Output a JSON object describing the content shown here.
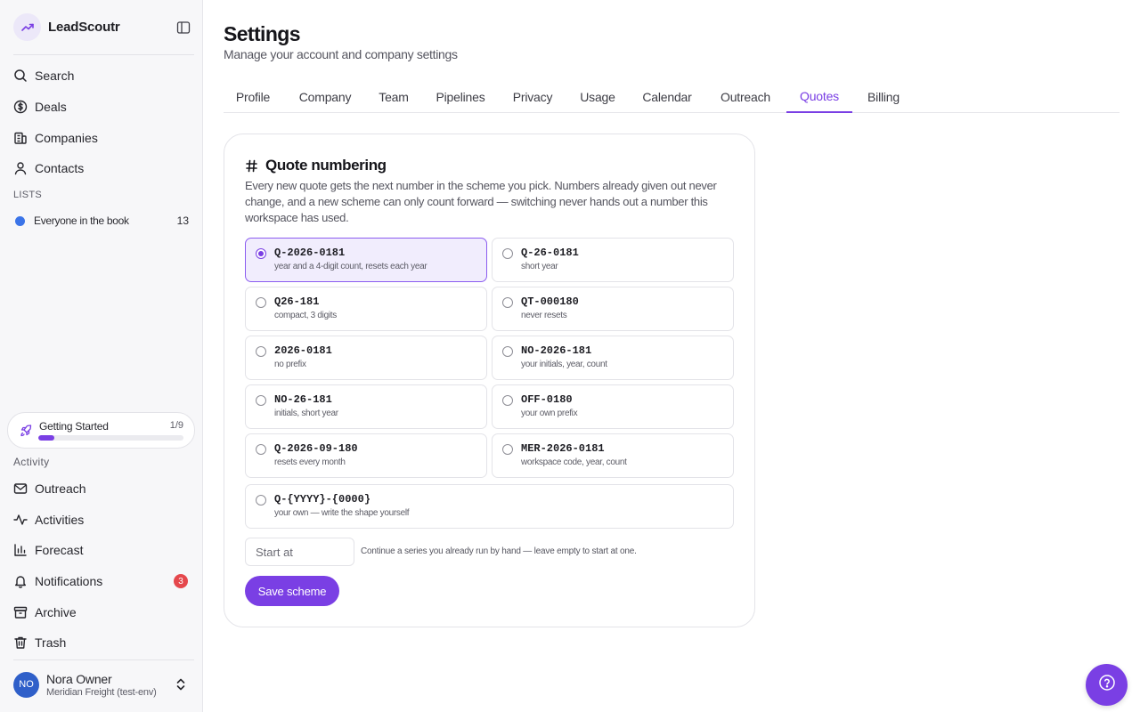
{
  "app": {
    "name": "LeadScoutr"
  },
  "sidebar": {
    "nav": [
      {
        "label": "Search",
        "icon": "search-icon"
      },
      {
        "label": "Deals",
        "icon": "dollar-icon"
      },
      {
        "label": "Companies",
        "icon": "building-icon"
      },
      {
        "label": "Contacts",
        "icon": "user-icon"
      }
    ],
    "lists_label": "LISTS",
    "lists": [
      {
        "name": "Everyone in the book",
        "count": "13",
        "color": "#3b74e8"
      }
    ],
    "getting_started": {
      "title": "Getting Started",
      "progress_text": "1/9",
      "progress": 0.11
    },
    "activity_label": "Activity",
    "activity": [
      {
        "label": "Outreach",
        "icon": "mail-icon"
      },
      {
        "label": "Activities",
        "icon": "activity-icon"
      },
      {
        "label": "Forecast",
        "icon": "bar-chart-icon"
      },
      {
        "label": "Notifications",
        "icon": "bell-icon",
        "badge": "3"
      },
      {
        "label": "Archive",
        "icon": "archive-icon"
      },
      {
        "label": "Trash",
        "icon": "trash-icon"
      }
    ],
    "user": {
      "initials": "NO",
      "name": "Nora Owner",
      "org": "Meridian Freight (test-env)"
    }
  },
  "page": {
    "title": "Settings",
    "subtitle": "Manage your account and company settings"
  },
  "tabs": [
    "Profile",
    "Company",
    "Team",
    "Pipelines",
    "Privacy",
    "Usage",
    "Calendar",
    "Outreach",
    "Quotes",
    "Billing"
  ],
  "active_tab": "Quotes",
  "quote_numbering": {
    "title": "Quote numbering",
    "description": "Every new quote gets the next number in the scheme you pick. Numbers already given out never change, and a new scheme can only count forward — switching never hands out a number this workspace has used.",
    "options": [
      {
        "code": "Q-2026-0181",
        "desc": "year and a 4-digit count, resets each year",
        "selected": true
      },
      {
        "code": "Q-26-0181",
        "desc": "short year",
        "selected": false
      },
      {
        "code": "Q26-181",
        "desc": "compact, 3 digits",
        "selected": false
      },
      {
        "code": "QT-000180",
        "desc": "never resets",
        "selected": false
      },
      {
        "code": "2026-0181",
        "desc": "no prefix",
        "selected": false
      },
      {
        "code": "NO-2026-181",
        "desc": "your initials, year, count",
        "selected": false
      },
      {
        "code": "NO-26-181",
        "desc": "initials, short year",
        "selected": false
      },
      {
        "code": "OFF-0180",
        "desc": "your own prefix",
        "selected": false
      },
      {
        "code": "Q-2026-09-180",
        "desc": "resets every month",
        "selected": false
      },
      {
        "code": "MER-2026-0181",
        "desc": "workspace code, year, count",
        "selected": false
      },
      {
        "code": "Q-{YYYY}-{0000}",
        "desc": "your own — write the shape yourself",
        "selected": false
      }
    ],
    "start_at": {
      "placeholder": "Start at",
      "value": "",
      "hint": "Continue a series you already run by hand — leave empty to start at one."
    },
    "save_label": "Save scheme"
  },
  "colors": {
    "accent": "#7a3fe4",
    "badge": "#e5484d",
    "avatar": "#2f5fc9"
  }
}
